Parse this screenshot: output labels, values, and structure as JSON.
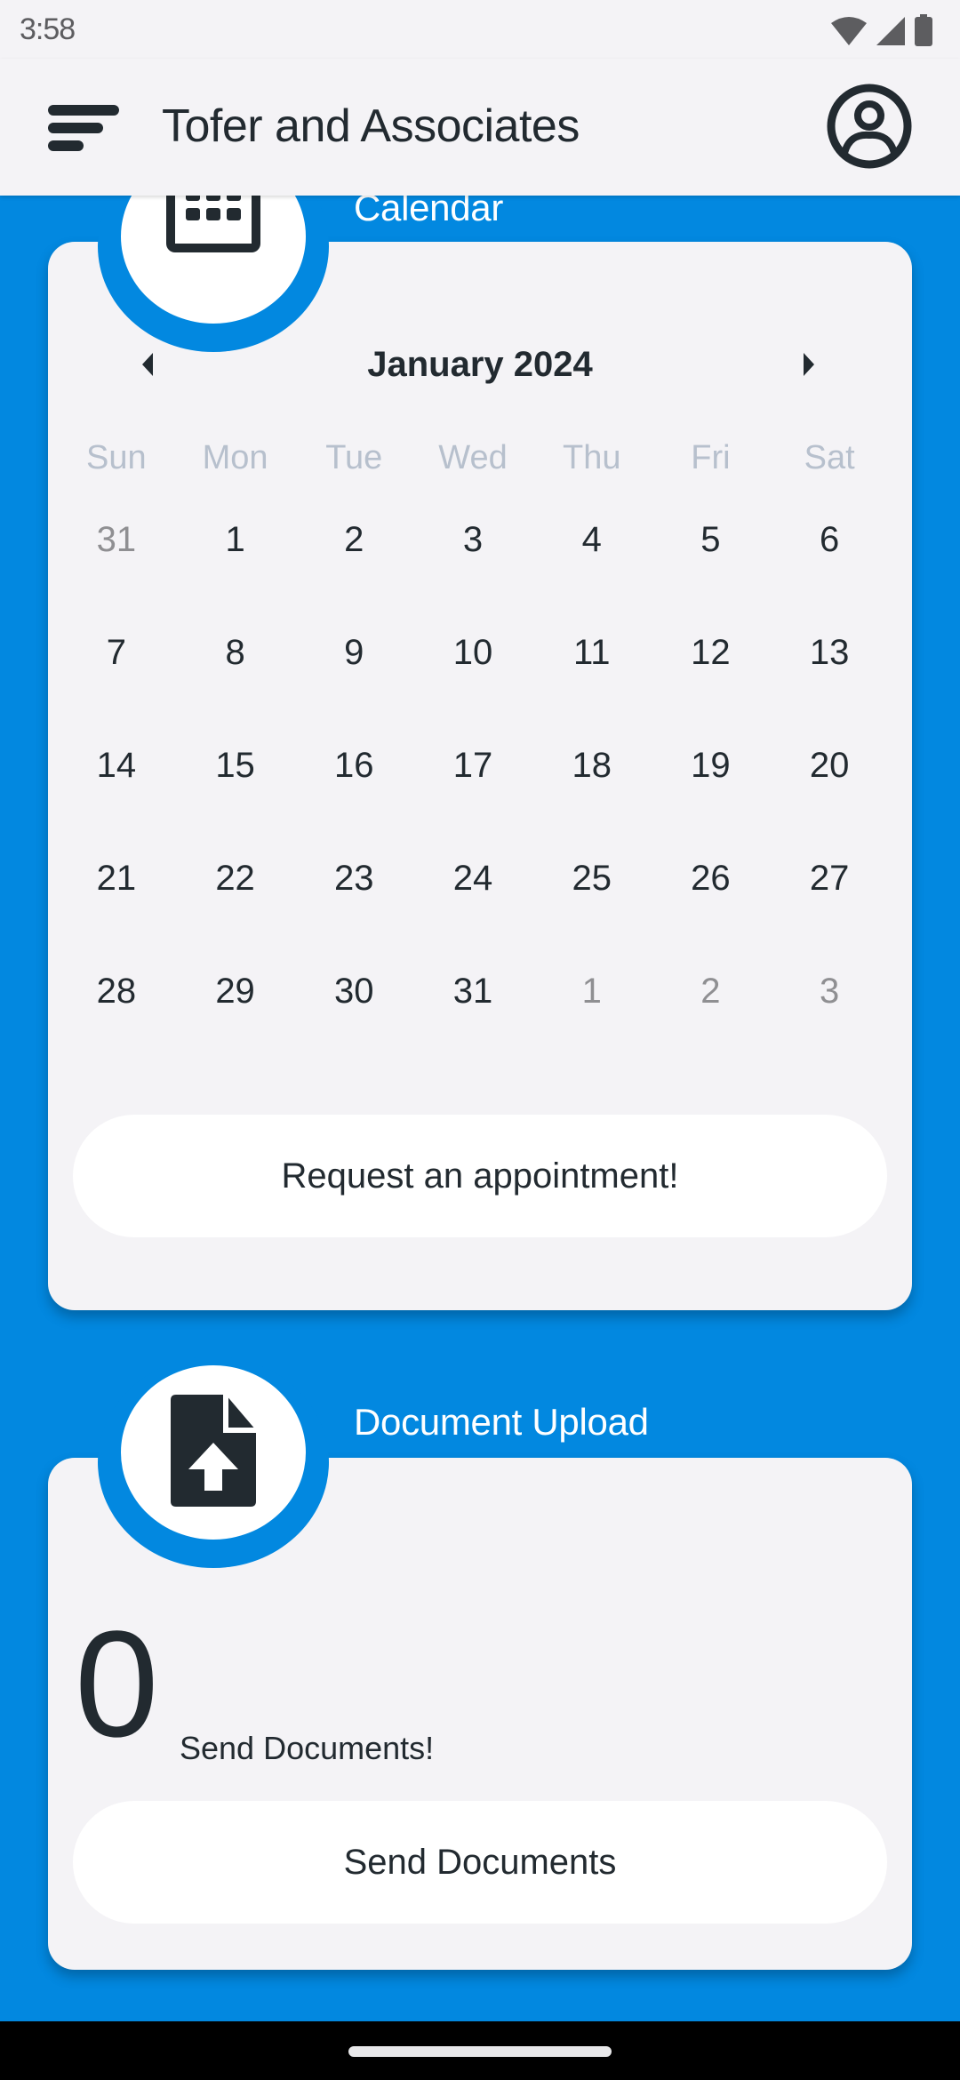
{
  "status_bar": {
    "time": "3:58",
    "icons": [
      "wifi-icon",
      "cellular-signal-icon",
      "battery-icon"
    ]
  },
  "app_bar": {
    "title": "Tofer and Associates",
    "menu_icon": "menu-icon",
    "account_icon": "account-circle-icon"
  },
  "calendar_section": {
    "title": "Calendar",
    "icon": "calendar-icon",
    "month_label": "January 2024",
    "prev_icon": "chevron-left-icon",
    "next_icon": "chevron-right-icon",
    "weekdays": [
      "Sun",
      "Mon",
      "Tue",
      "Wed",
      "Thu",
      "Fri",
      "Sat"
    ],
    "days": [
      {
        "label": "31",
        "current_month": false
      },
      {
        "label": "1",
        "current_month": true
      },
      {
        "label": "2",
        "current_month": true
      },
      {
        "label": "3",
        "current_month": true
      },
      {
        "label": "4",
        "current_month": true
      },
      {
        "label": "5",
        "current_month": true
      },
      {
        "label": "6",
        "current_month": true
      },
      {
        "label": "7",
        "current_month": true
      },
      {
        "label": "8",
        "current_month": true
      },
      {
        "label": "9",
        "current_month": true
      },
      {
        "label": "10",
        "current_month": true
      },
      {
        "label": "11",
        "current_month": true
      },
      {
        "label": "12",
        "current_month": true
      },
      {
        "label": "13",
        "current_month": true
      },
      {
        "label": "14",
        "current_month": true
      },
      {
        "label": "15",
        "current_month": true
      },
      {
        "label": "16",
        "current_month": true
      },
      {
        "label": "17",
        "current_month": true
      },
      {
        "label": "18",
        "current_month": true
      },
      {
        "label": "19",
        "current_month": true
      },
      {
        "label": "20",
        "current_month": true
      },
      {
        "label": "21",
        "current_month": true
      },
      {
        "label": "22",
        "current_month": true
      },
      {
        "label": "23",
        "current_month": true
      },
      {
        "label": "24",
        "current_month": true
      },
      {
        "label": "25",
        "current_month": true
      },
      {
        "label": "26",
        "current_month": true
      },
      {
        "label": "27",
        "current_month": true
      },
      {
        "label": "28",
        "current_month": true
      },
      {
        "label": "29",
        "current_month": true
      },
      {
        "label": "30",
        "current_month": true
      },
      {
        "label": "31",
        "current_month": true
      },
      {
        "label": "1",
        "current_month": false
      },
      {
        "label": "2",
        "current_month": false
      },
      {
        "label": "3",
        "current_month": false
      }
    ],
    "request_button_label": "Request an appointment!"
  },
  "document_section": {
    "title": "Document Upload",
    "icon": "file-upload-icon",
    "count": "0",
    "caption": "Send Documents!",
    "send_button_label": "Send Documents"
  },
  "colors": {
    "primary": "#0288e0",
    "surface": "#f4f3f6",
    "text": "#222a30",
    "muted_text": "#8f8f92",
    "weekday_text": "#b7c0cd"
  }
}
